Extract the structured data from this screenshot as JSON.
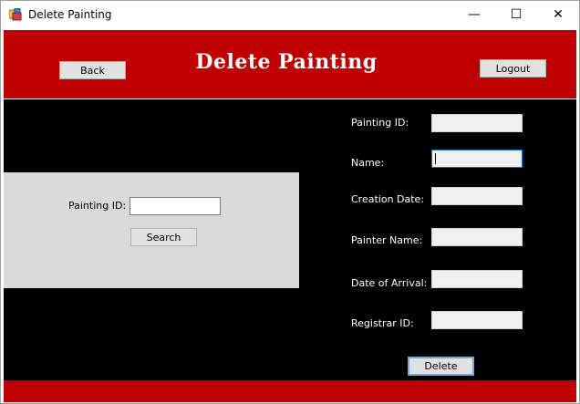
{
  "window": {
    "title": "Delete Painting",
    "minimize_glyph": "—",
    "maximize_glyph": "☐",
    "close_glyph": "✕",
    "icon": "app-form-icon"
  },
  "header": {
    "title": "Delete Painting",
    "back_label": "Back",
    "logout_label": "Logout",
    "color": "#c00000"
  },
  "search": {
    "label": "Painting ID:",
    "value": "",
    "button_label": "Search"
  },
  "details": {
    "fields": [
      {
        "label": "Painting ID:",
        "value": ""
      },
      {
        "label": "Name:",
        "value": ""
      },
      {
        "label": "Creation Date:",
        "value": ""
      },
      {
        "label": "Painter Name:",
        "value": ""
      },
      {
        "label": "Date of Arrival:",
        "value": ""
      },
      {
        "label": "Registrar ID:",
        "value": ""
      }
    ],
    "delete_label": "Delete"
  }
}
